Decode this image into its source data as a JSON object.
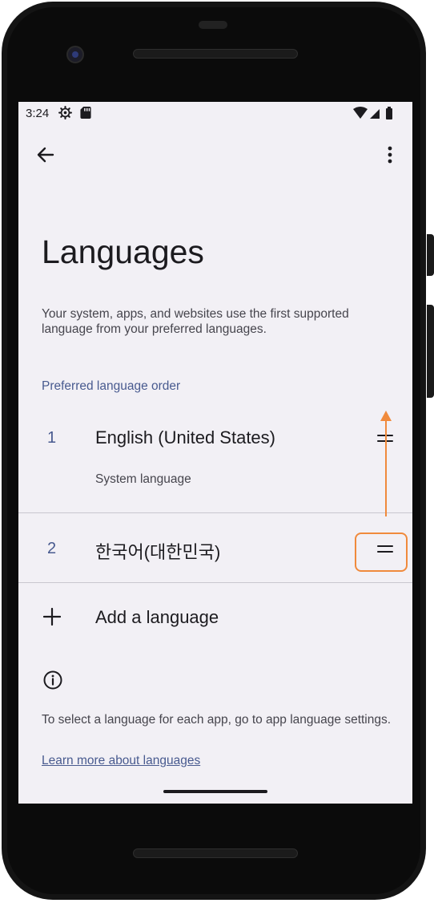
{
  "status_bar": {
    "time": "3:24",
    "icons_left": [
      "settings-gear-icon",
      "sd-card-icon"
    ],
    "icons_right": [
      "wifi-icon",
      "cell-signal-icon",
      "battery-icon"
    ]
  },
  "toolbar": {
    "back_icon": "arrow-back-icon",
    "more_icon": "more-vert-icon"
  },
  "page": {
    "title": "Languages",
    "description": "Your system, apps, and websites use the first supported language from your preferred languages."
  },
  "preferred": {
    "header": "Preferred language order",
    "languages": [
      {
        "number": "1",
        "name": "English (United States)",
        "subtitle": "System language",
        "drag_icon": "drag-handle-icon"
      },
      {
        "number": "2",
        "name": "한국어(대한민국)",
        "drag_icon": "drag-handle-icon"
      }
    ]
  },
  "add_language": {
    "icon": "plus-icon",
    "label": "Add a language"
  },
  "footer": {
    "info_icon": "info-icon",
    "text": "To select a language for each app, go to app language settings.",
    "link": "Learn more about languages"
  },
  "annotation": {
    "color": "#f08a3c",
    "hint": "drag-up-arrow"
  },
  "colors": {
    "background": "#f2f0f5",
    "accent": "#485a8f",
    "text_primary": "#1c1b1f",
    "text_secondary": "#46454d",
    "divider": "#c9c7cf"
  }
}
